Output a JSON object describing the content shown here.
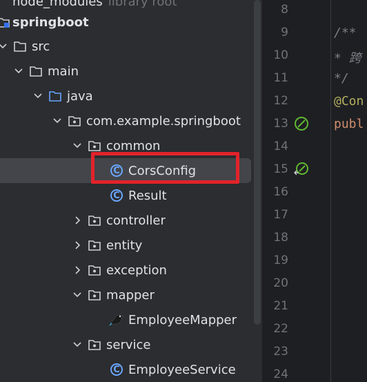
{
  "project": {
    "top_item": {
      "name": "node_modules",
      "suffix": "library root"
    },
    "root": "springboot",
    "items": [
      {
        "label": "src"
      },
      {
        "label": "main"
      },
      {
        "label": "java"
      },
      {
        "label": "com.example.springboot"
      },
      {
        "label": "common"
      },
      {
        "label": "CorsConfig"
      },
      {
        "label": "Result"
      },
      {
        "label": "controller"
      },
      {
        "label": "entity"
      },
      {
        "label": "exception"
      },
      {
        "label": "mapper"
      },
      {
        "label": "EmployeeMapper"
      },
      {
        "label": "service"
      },
      {
        "label": "EmployeeService"
      }
    ]
  },
  "editor": {
    "line_numbers": [
      "8",
      "9",
      "10",
      "11",
      "12",
      "13",
      "14",
      "15",
      "16",
      "17",
      "18",
      "19",
      "20",
      "21",
      "22",
      "23",
      "24"
    ],
    "code": {
      "line9": "/**",
      "line10": " * 跨",
      "line11": " */",
      "line12": "@Con",
      "line13": "publ"
    }
  },
  "colors": {
    "accent_highlight": "#e2232b",
    "class_icon": "#6aa7ff",
    "folder_icon": "#ced0d6",
    "selected_row": "#43454a"
  }
}
